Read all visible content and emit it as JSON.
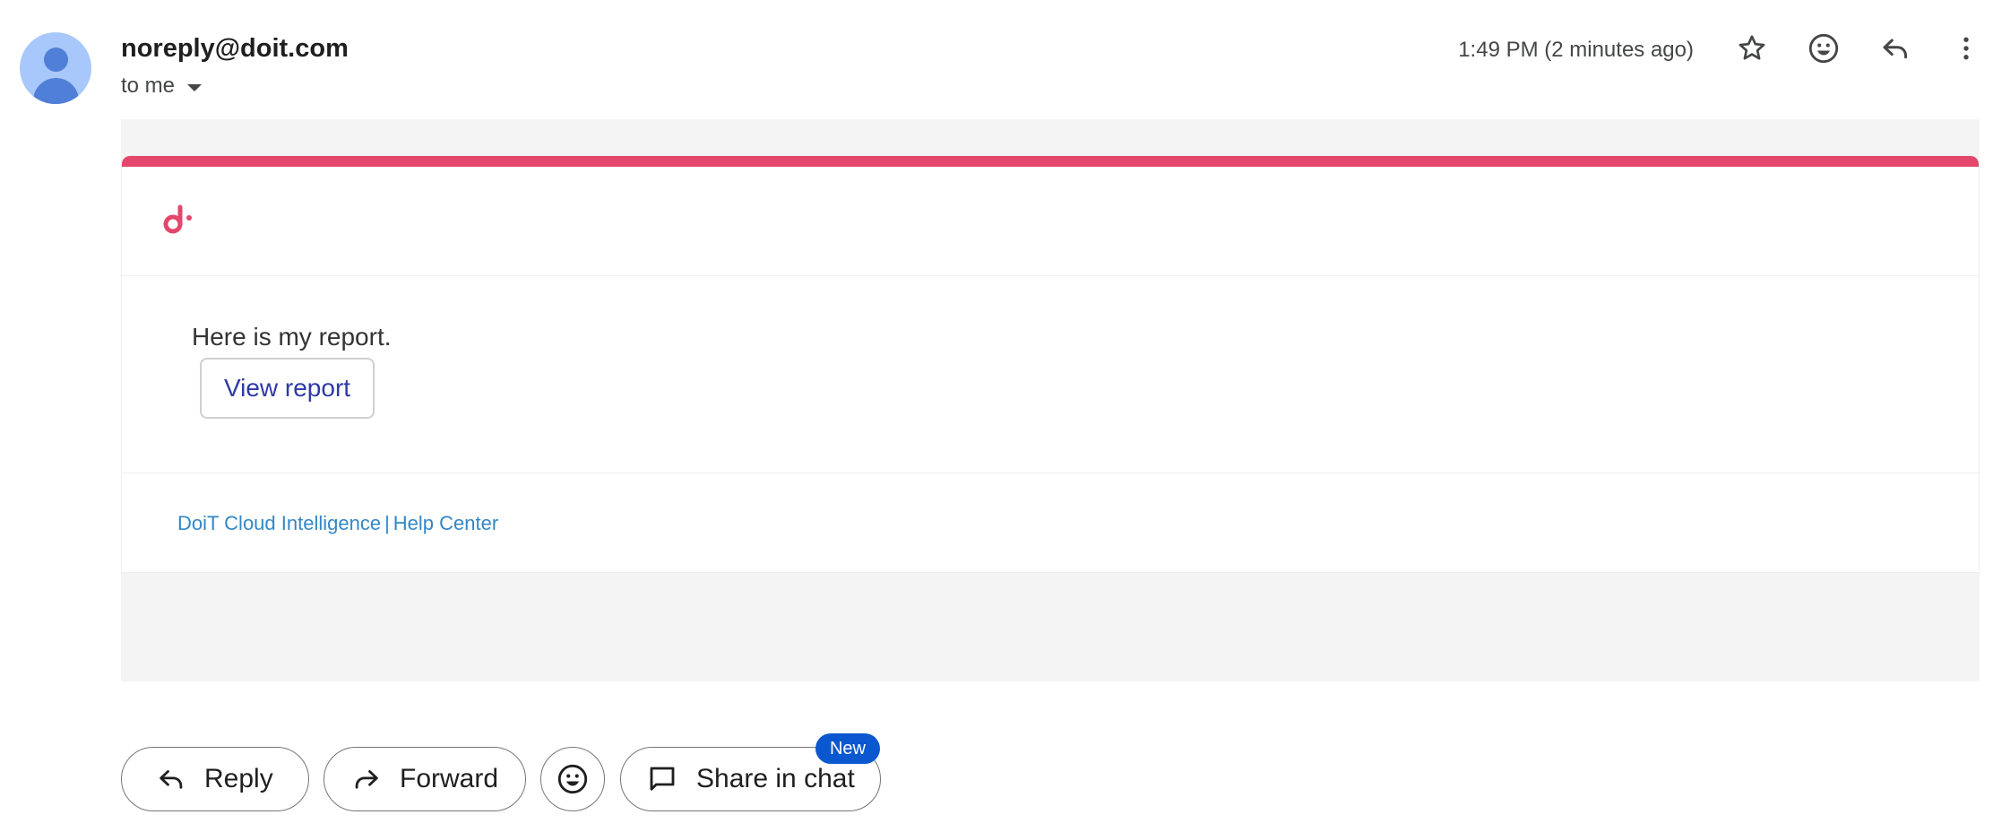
{
  "header": {
    "sender": "noreply@doit.com",
    "recipient": "to me",
    "timestamp": "1:49 PM (2 minutes ago)",
    "icons": [
      "star-icon",
      "emoji-icon",
      "reply-icon",
      "more-vert-icon"
    ]
  },
  "email": {
    "brand_color": "#e3476b",
    "logo": "doit-logo",
    "message": "Here is my report.",
    "view_report_label": "View report",
    "footer": {
      "link1": "DoiT Cloud Intelligence",
      "separator": "|",
      "link2": "Help Center"
    }
  },
  "actions": {
    "reply_label": "Reply",
    "forward_label": "Forward",
    "share_label": "Share in chat",
    "new_badge": "New",
    "badge_color": "#0b57d0"
  }
}
